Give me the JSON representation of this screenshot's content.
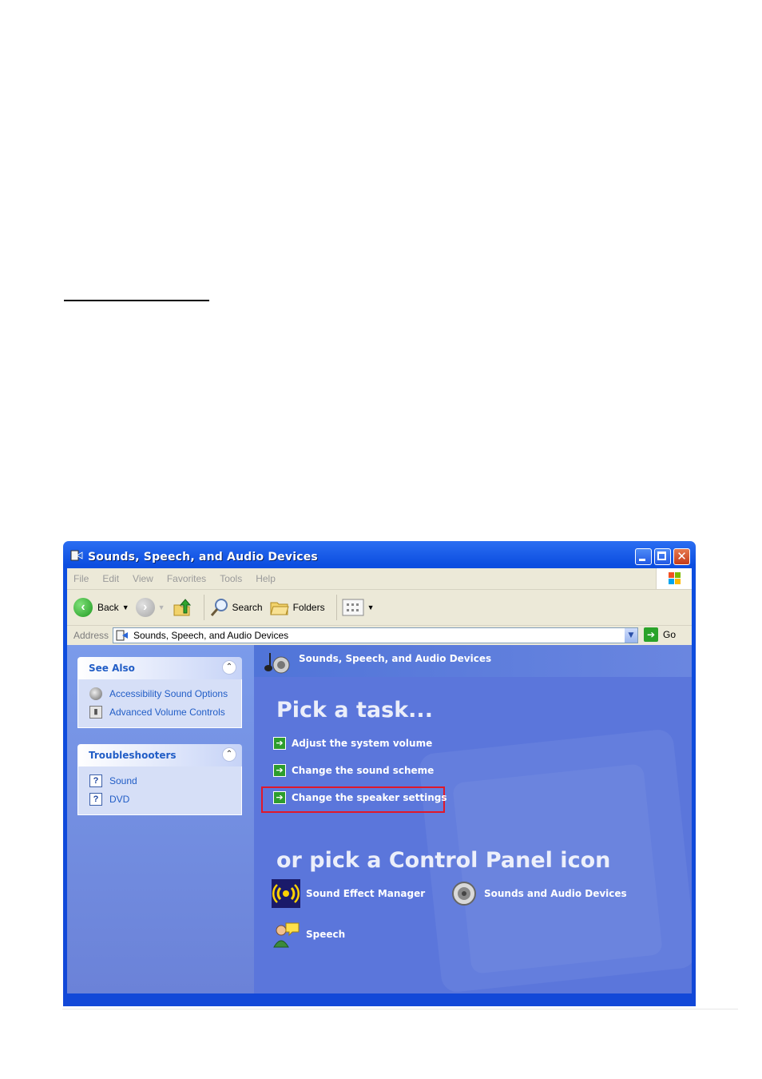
{
  "window": {
    "title": "Sounds, Speech, and Audio Devices",
    "caption_buttons": [
      "minimize-icon",
      "maximize-icon",
      "close-icon"
    ]
  },
  "menu": [
    "File",
    "Edit",
    "View",
    "Favorites",
    "Tools",
    "Help"
  ],
  "toolbar": {
    "back_label": "Back",
    "search_label": "Search",
    "folders_label": "Folders"
  },
  "address": {
    "label": "Address",
    "value": "Sounds, Speech, and Audio Devices",
    "go_label": "Go"
  },
  "sidebar": {
    "see_also": {
      "title": "See Also",
      "items": [
        {
          "label": "Accessibility Sound Options",
          "icon": "speaker-icon"
        },
        {
          "label": "Advanced Volume Controls",
          "icon": "volume-control-icon"
        }
      ]
    },
    "troubleshooters": {
      "title": "Troubleshooters",
      "items": [
        {
          "label": "Sound",
          "icon": "help-icon"
        },
        {
          "label": "DVD",
          "icon": "help-icon"
        }
      ]
    }
  },
  "main": {
    "header_title": "Sounds, Speech, and Audio Devices",
    "pick_task": "Pick a task...",
    "tasks": [
      "Adjust the system volume",
      "Change the sound scheme",
      "Change the speaker settings"
    ],
    "highlighted_task_index": 2,
    "highlight_color": "#e0182a",
    "or_pick_icon": "or pick a Control Panel icon",
    "icons": [
      {
        "label": "Sound Effect Manager",
        "icon": "sound-effect-icon"
      },
      {
        "label": "Sounds and Audio Devices",
        "icon": "speaker-icon"
      },
      {
        "label": "Speech",
        "icon": "speech-icon"
      }
    ]
  },
  "colors": {
    "title_bar": "#0d4ee0",
    "task_pane": "#5b76db",
    "link": "#215dc6"
  }
}
